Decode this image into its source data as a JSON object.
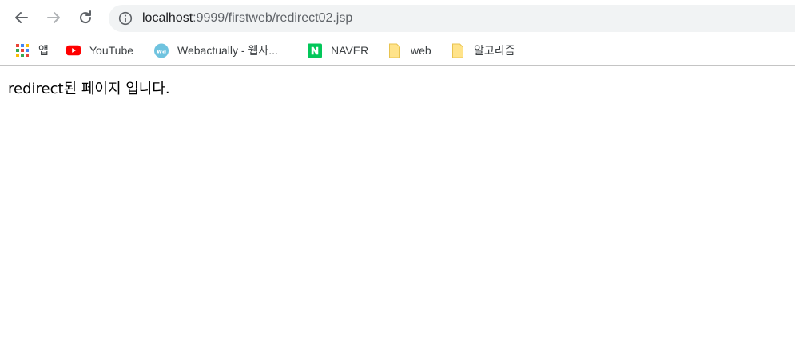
{
  "browser": {
    "address_bar": {
      "host": "localhost",
      "path": ":9999/firstweb/redirect02.jsp"
    },
    "bookmarks": [
      {
        "label": "앱",
        "icon": "apps-grid-icon"
      },
      {
        "label": "YouTube",
        "icon": "youtube-icon"
      },
      {
        "label": "Webactually - 웹사...",
        "icon": "webactually-icon"
      },
      {
        "label": "NAVER",
        "icon": "naver-icon"
      },
      {
        "label": "web",
        "icon": "folder-icon"
      },
      {
        "label": "알고리즘",
        "icon": "folder-icon"
      }
    ],
    "colors": {
      "youtube_red": "#ff0000",
      "naver_green": "#03c75a",
      "webactually_blue": "#6fc3df",
      "folder_yellow": "#ffe38a"
    }
  },
  "page": {
    "body_text": "redirect된 페이지 입니다."
  }
}
